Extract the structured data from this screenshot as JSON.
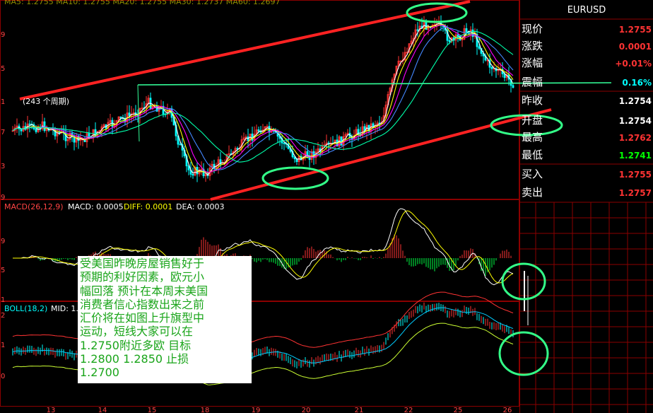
{
  "header": {
    "ma_label": "MA5: 1.2755  MA10: 1.2755  MA20: 1.2755  MA30: 1.2737  MA60: 1.2697",
    "period_label": "(243 个周期)"
  },
  "quote": {
    "symbol": "EURUSD",
    "rows": [
      {
        "label": "现价",
        "value": "1.2755",
        "color": "#ff3333"
      },
      {
        "label": "涨跌",
        "value": "0.0001",
        "color": "#ff3333"
      },
      {
        "label": "涨幅",
        "value": "+0.01%",
        "color": "#ff3333"
      },
      {
        "label": "震幅",
        "value": "0.16%",
        "color": "#00ffff"
      },
      {
        "label": "昨收",
        "value": "1.2754",
        "color": "#ffffff"
      },
      {
        "label": "开盘",
        "value": "1.2754",
        "color": "#ffffff"
      },
      {
        "label": "最高",
        "value": "1.2762",
        "color": "#ff3333"
      },
      {
        "label": "最低",
        "value": "1.2741",
        "color": "#00ff00"
      },
      {
        "label": "买入",
        "value": "1.2755",
        "color": "#ff3333"
      },
      {
        "label": "卖出",
        "value": "1.2757",
        "color": "#ff3333"
      }
    ]
  },
  "macd": {
    "label": "MACD(26,12,9)",
    "macd_value": "MACD: 0.0005",
    "diff_value": "DIFF: 0.0001",
    "dea_value": "DEA: 0.0003"
  },
  "boll": {
    "label": "BOLL(18,2)",
    "mid_value": "MID: 1."
  },
  "axis_labels": {
    "price_ticks": [
      "9",
      "5",
      "1",
      "7",
      "3",
      "9"
    ],
    "macd_ticks": [
      "9",
      "5",
      "1"
    ],
    "boll_ticks": [
      "2",
      "1",
      "0"
    ],
    "date_ticks": [
      "13",
      "14",
      "15",
      "18",
      "19",
      "20",
      "21",
      "22",
      "25",
      "26"
    ]
  },
  "annotation": {
    "lines": [
      "受美国昨晚房屋销售好于",
      "预期的利好因素，欧元小",
      "幅回落 预计在本周末美国",
      "消费者信心指数出来之前",
      "汇价将在如图上升旗型中",
      "运动，短线大家可以在",
      "1.2750附近多欧 目标",
      "1.2800  1.2850  止损",
      "1.2700"
    ]
  },
  "colors": {
    "up": "#ff3333",
    "down": "#00ffff",
    "trendline": "#ff2222",
    "horizontal": "#33ff99",
    "ellipse": "#33ff88",
    "grid": "#8b0000",
    "ma5": "#ffffff",
    "ma10": "#ffff00",
    "ma20": "#ff00ff",
    "ma30": "#4488ff",
    "ma60": "#00ffaa"
  },
  "chart_data": {
    "type": "candlestick",
    "symbol": "EURUSD",
    "panels": [
      "price",
      "MACD",
      "BOLL"
    ],
    "description_values": {
      "current": 1.2755,
      "change": 0.0001,
      "change_pct": 0.01,
      "amplitude_pct": 0.16,
      "prev_close": 1.2754,
      "open": 1.2754,
      "high": 1.2762,
      "low": 1.2741,
      "bid": 1.2755,
      "ask": 1.2757
    },
    "macd_params": [
      26,
      12,
      9
    ],
    "macd": 0.0005,
    "diff": 0.0001,
    "dea": 0.0003,
    "boll_params": [
      18,
      2
    ]
  }
}
